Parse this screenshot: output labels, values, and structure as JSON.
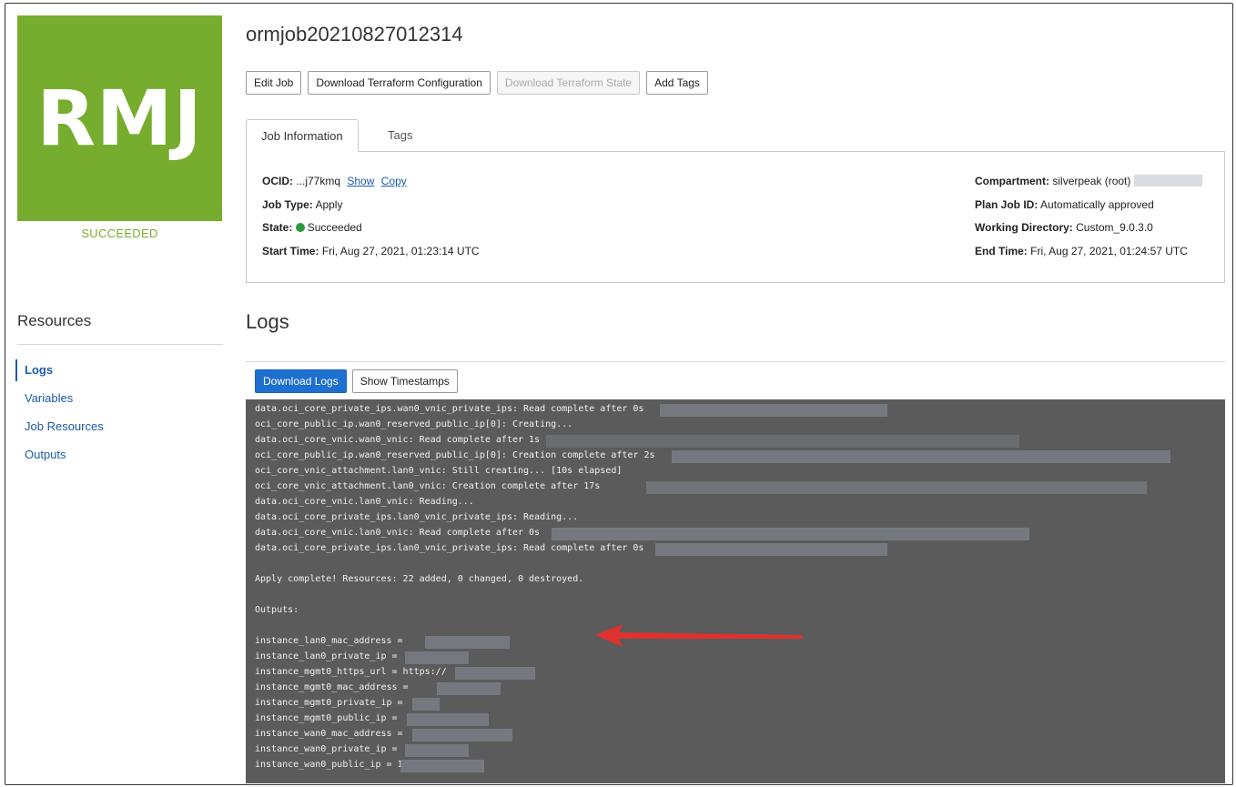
{
  "badge": {
    "initials": "RMJ",
    "status": "SUCCEEDED",
    "color": "#77ad2e"
  },
  "resources": {
    "title": "Resources",
    "items": [
      {
        "label": "Logs",
        "active": true
      },
      {
        "label": "Variables"
      },
      {
        "label": "Job Resources"
      },
      {
        "label": "Outputs"
      }
    ]
  },
  "job": {
    "title": "ormjob20210827012314",
    "actions": {
      "edit": "Edit Job",
      "download_config": "Download Terraform Configuration",
      "download_state": "Download Terraform State",
      "add_tags": "Add Tags"
    }
  },
  "tabs": {
    "info": "Job Information",
    "tags": "Tags"
  },
  "info": {
    "ocid_label": "OCID:",
    "ocid_value": "...j77kmq",
    "show": "Show",
    "copy": "Copy",
    "job_type_label": "Job Type:",
    "job_type_value": "Apply",
    "state_label": "State:",
    "state_value": "Succeeded",
    "start_label": "Start Time:",
    "start_value": "Fri, Aug 27, 2021, 01:23:14 UTC",
    "compartment_label": "Compartment:",
    "compartment_value": "silverpeak (root)",
    "plan_label": "Plan Job ID:",
    "plan_value": "Automatically approved",
    "workdir_label": "Working Directory:",
    "workdir_value": "Custom_9.0.3.0",
    "end_label": "End Time:",
    "end_value": "Fri, Aug 27, 2021, 01:24:57 UTC"
  },
  "logs": {
    "title": "Logs",
    "download": "Download Logs",
    "timestamps": "Show Timestamps",
    "lines": [
      "data.oci_core_private_ips.wan0_vnic_private_ips: Read complete after 0s",
      "oci_core_public_ip.wan0_reserved_public_ip[0]: Creating...",
      "data.oci_core_vnic.wan0_vnic: Read complete after 1s",
      "oci_core_public_ip.wan0_reserved_public_ip[0]: Creation complete after 2s",
      "oci_core_vnic_attachment.lan0_vnic: Still creating... [10s elapsed]",
      "oci_core_vnic_attachment.lan0_vnic: Creation complete after 17s",
      "data.oci_core_vnic.lan0_vnic: Reading...",
      "data.oci_core_private_ips.lan0_vnic_private_ips: Reading...",
      "data.oci_core_vnic.lan0_vnic: Read complete after 0s",
      "data.oci_core_private_ips.lan0_vnic_private_ips: Read complete after 0s",
      "",
      "Apply complete! Resources: 22 added, 0 changed, 0 destroyed.",
      "",
      "Outputs:",
      "",
      "instance_lan0_mac_address =",
      "instance_lan0_private_ip =",
      "instance_mgmt0_https_url = https://",
      "instance_mgmt0_mac_address =",
      "instance_mgmt0_private_ip =",
      "instance_mgmt0_public_ip =",
      "instance_wan0_mac_address =",
      "instance_wan0_private_ip =",
      "instance_wan0_public_ip = 1"
    ]
  },
  "colors": {
    "accent": "#1d6fd0",
    "console_bg": "#5b5b5b",
    "arrow": "#e0312e",
    "success": "#2d9a3e"
  }
}
